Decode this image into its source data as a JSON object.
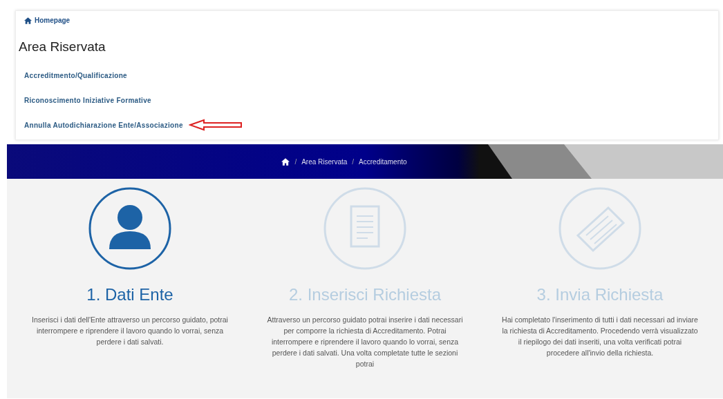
{
  "menu": {
    "home_link": "Homepage",
    "title": "Area Riservata",
    "links": [
      {
        "label": "Accreditmento/Qualificazione",
        "pointed": false
      },
      {
        "label": "Riconoscimento Iniziative Formative",
        "pointed": false
      },
      {
        "label": "Annulla Autodichiarazione Ente/Associazione",
        "pointed": true
      }
    ]
  },
  "breadcrumb": {
    "separator": "/",
    "items": [
      "Area Riservata",
      "Accreditamento"
    ]
  },
  "steps": [
    {
      "kind": "person",
      "selected": true,
      "title": "1. Dati Ente",
      "description": "Inserisci i dati dell'Ente attraverso un percorso guidato, potrai interrompere e riprendere il lavoro quando lo vorrai, senza perdere i dati salvati."
    },
    {
      "kind": "document",
      "selected": false,
      "title": "2. Inserisci Richiesta",
      "description": "Attraverso un percorso guidato potrai inserire i dati necessari per comporre la richiesta di Accreditamento. Potrai interrompere e riprendere il lavoro quando lo vorrai, senza perdere i dati salvati. Una volta completate tutte le sezioni potrai"
    },
    {
      "kind": "send",
      "selected": false,
      "title": "3. Invia Richiesta",
      "description": "Hai completato l'inserimento di tutti i dati necessari ad inviare la richiesta di Accreditamento. Procedendo verrà visualizzato il riepilogo dei dati inseriti, una volta verificati potrai procedere all'invio della richiesta."
    }
  ]
}
